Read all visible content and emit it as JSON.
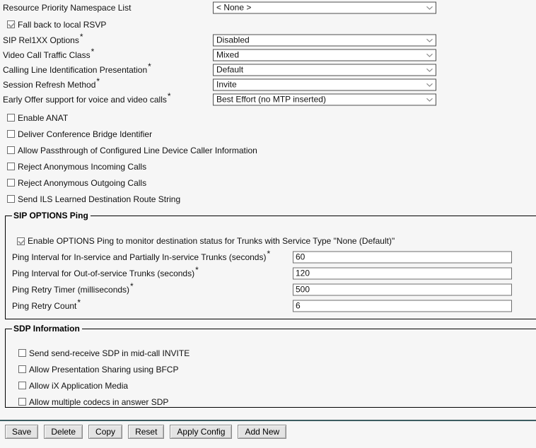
{
  "top_fields": [
    {
      "label": "Resource Priority Namespace List",
      "required": false,
      "control": "select",
      "value": "< None >",
      "name": "resource-priority-namespace-list"
    },
    {
      "label": "SIP Rel1XX Options",
      "required": true,
      "control": "select",
      "value": "Disabled",
      "name": "sip-rel1xx-options"
    },
    {
      "label": "Video Call Traffic Class",
      "required": true,
      "control": "select",
      "value": "Mixed",
      "name": "video-call-traffic-class"
    },
    {
      "label": "Calling Line Identification Presentation",
      "required": true,
      "control": "select",
      "value": "Default",
      "name": "calling-line-identification-presentation"
    },
    {
      "label": "Session Refresh Method",
      "required": true,
      "control": "select",
      "value": "Invite",
      "name": "session-refresh-method"
    },
    {
      "label": "Early Offer support for voice and video calls",
      "required": true,
      "control": "select",
      "value": "Best Effort (no MTP inserted)",
      "name": "early-offer-support"
    }
  ],
  "fallback_checkbox": {
    "label": "Fall back to local RSVP",
    "checked": true,
    "name": "fall-back-to-local-rsvp"
  },
  "option_checkboxes": [
    {
      "label": "Enable ANAT",
      "checked": false,
      "name": "enable-anat"
    },
    {
      "label": "Deliver Conference Bridge Identifier",
      "checked": false,
      "name": "deliver-conference-bridge-identifier"
    },
    {
      "label": "Allow Passthrough of Configured Line Device Caller Information",
      "checked": false,
      "name": "allow-passthrough-caller-information"
    },
    {
      "label": "Reject Anonymous Incoming Calls",
      "checked": false,
      "name": "reject-anonymous-incoming-calls"
    },
    {
      "label": "Reject Anonymous Outgoing Calls",
      "checked": false,
      "name": "reject-anonymous-outgoing-calls"
    },
    {
      "label": "Send ILS Learned Destination Route String",
      "checked": false,
      "name": "send-ils-learned-destination-route-string"
    }
  ],
  "sip_options_ping": {
    "legend": "SIP OPTIONS Ping",
    "enable_checkbox": {
      "label": "Enable OPTIONS Ping to monitor destination status for Trunks with Service Type \"None (Default)\"",
      "checked": true,
      "name": "enable-options-ping"
    },
    "fields": [
      {
        "label": "Ping Interval for In-service and Partially In-service Trunks (seconds)",
        "required": true,
        "value": "60",
        "name": "ping-interval-in-service"
      },
      {
        "label": "Ping Interval for Out-of-service Trunks (seconds)",
        "required": true,
        "value": "120",
        "name": "ping-interval-out-of-service"
      },
      {
        "label": "Ping Retry Timer (milliseconds)",
        "required": true,
        "value": "500",
        "name": "ping-retry-timer"
      },
      {
        "label": "Ping Retry Count",
        "required": true,
        "value": "6",
        "name": "ping-retry-count"
      }
    ]
  },
  "sdp_information": {
    "legend": "SDP Information",
    "checkboxes": [
      {
        "label": "Send send-receive SDP in mid-call INVITE",
        "checked": false,
        "name": "send-send-receive-sdp-mid-call-invite"
      },
      {
        "label": "Allow Presentation Sharing using BFCP",
        "checked": false,
        "name": "allow-presentation-sharing-bfcp"
      },
      {
        "label": "Allow iX Application Media",
        "checked": false,
        "name": "allow-ix-application-media"
      },
      {
        "label": "Allow multiple codecs in answer SDP",
        "checked": false,
        "name": "allow-multiple-codecs-answer-sdp"
      }
    ]
  },
  "footer_buttons": [
    {
      "label": "Save",
      "name": "save-button"
    },
    {
      "label": "Delete",
      "name": "delete-button"
    },
    {
      "label": "Copy",
      "name": "copy-button"
    },
    {
      "label": "Reset",
      "name": "reset-button"
    },
    {
      "label": "Apply Config",
      "name": "apply-config-button"
    },
    {
      "label": "Add New",
      "name": "add-new-button"
    }
  ],
  "colors": {
    "background": "#f6f6f6",
    "footer_rule": "#3d5d61",
    "border": "#000000",
    "input_border": "#6e6e6e",
    "check_mark": "#9a9a9a"
  }
}
